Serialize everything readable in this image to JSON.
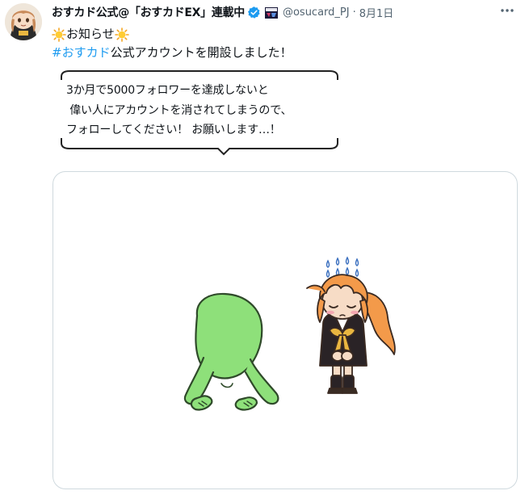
{
  "tweet": {
    "display_name": "おすカド公式@「おすカドEX」連載中",
    "handle": "@osucard_PJ",
    "separator": "·",
    "date": "8月1日",
    "line1_text": "お知らせ",
    "hashtag": "#おすカド",
    "line2_text": " 公式アカウントを開設しました！",
    "bubble_lines": [
      "3か月で5000フォロワーを達成しないと",
      " 偉い人にアカウントを消されてしまうので、",
      "フォローしてください！ お願いします…！"
    ]
  },
  "icons": {
    "verified": "verified-badge-icon",
    "affiliate": "affiliate-badge-icon",
    "more": "more-options-icon",
    "sun": "sun-emoji-icon"
  },
  "colors": {
    "link": "#1d9bf0",
    "verified": "#1d9bf0",
    "secondary_text": "#536471",
    "card_border": "#cfd9de",
    "creature_green": "#8ee07a",
    "girl_hair": "#f39a4a"
  }
}
